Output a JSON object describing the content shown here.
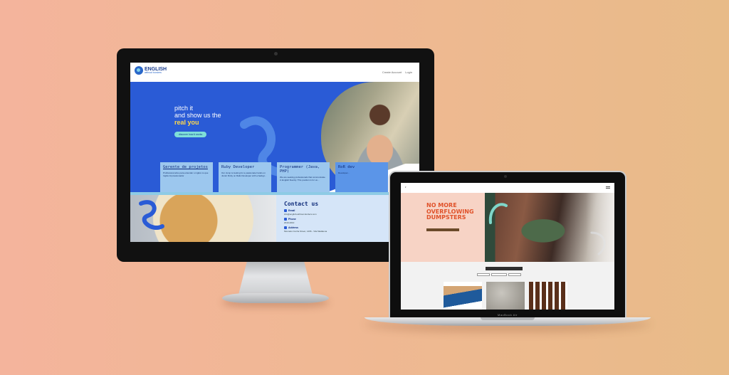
{
  "desktop_site": {
    "logo": {
      "line1": "ENGLISH",
      "line2": "without borders"
    },
    "header_links": [
      "Create Account",
      "Login"
    ],
    "hero": {
      "line1": "pitch it",
      "line2": "and show us the",
      "highlight": "real you",
      "cta": "discover how it works"
    },
    "jobs": [
      {
        "title": "Gerente de projetos",
        "text": "Profissional ativo para entender o inglês no que Inglês Impressionador"
      },
      {
        "title": "Ruby Developer",
        "text": "Our Jump is looking for a passionate hands on Junior Ruby on Rails Developer with a backgr..."
      },
      {
        "title": "Programmer (Java, PHP)",
        "text": "We are seeking professionals that communicate in English fluently. This position is for us..."
      },
      {
        "title": "RoR dev",
        "text": "Developer..."
      }
    ],
    "contact": {
      "title": "Contact us",
      "email_label": "Email",
      "email": "info@english-without-borders.com",
      "phone_label": "Phone",
      "phone": "2010-2010",
      "address_label": "Address",
      "address": "Mounato Cunha Street, 1466 - Vila Madalena"
    }
  },
  "laptop_site": {
    "hero_title": [
      "NO MORE",
      "OVERFLOWING",
      "DUMPSTERS"
    ],
    "device_label": "MacBook Air"
  },
  "colors": {
    "background_start": "#f4b49c",
    "background_end": "#e8bb88",
    "hero_blue": "#2a5bd6",
    "accent_yellow": "#ffd84a",
    "accent_orange": "#e0522a"
  }
}
